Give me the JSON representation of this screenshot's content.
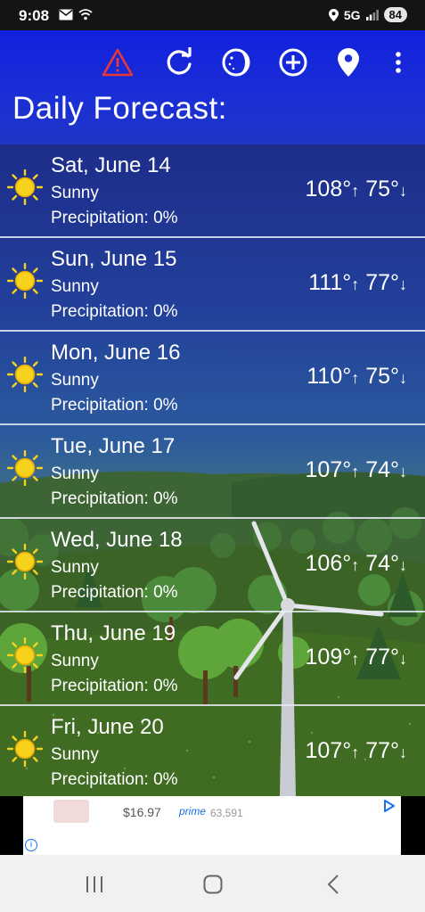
{
  "status_bar": {
    "time": "9:08",
    "network": "5G",
    "battery": "84"
  },
  "page_title": "Daily Forecast:",
  "toolbar_icons": [
    "alert-icon",
    "refresh-icon",
    "moon-icon",
    "add-location-icon",
    "location-pin-icon",
    "more-vert-icon"
  ],
  "days": [
    {
      "date": "Sat, June 14",
      "condition": "Sunny",
      "precipitation": "Precipitation:  0%",
      "high": "108°",
      "low": "75°"
    },
    {
      "date": "Sun, June 15",
      "condition": "Sunny",
      "precipitation": "Precipitation:  0%",
      "high": "111°",
      "low": "77°"
    },
    {
      "date": "Mon, June 16",
      "condition": "Sunny",
      "precipitation": "Precipitation:  0%",
      "high": "110°",
      "low": "75°"
    },
    {
      "date": "Tue, June 17",
      "condition": "Sunny",
      "precipitation": "Precipitation:  0%",
      "high": "107°",
      "low": "74°"
    },
    {
      "date": "Wed, June 18",
      "condition": "Sunny",
      "precipitation": "Precipitation:  0%",
      "high": "106°",
      "low": "74°"
    },
    {
      "date": "Thu, June 19",
      "condition": "Sunny",
      "precipitation": "Precipitation:  0%",
      "high": "109°",
      "low": "77°"
    },
    {
      "date": "Fri, June 20",
      "condition": "Sunny",
      "precipitation": "Precipitation:  0%",
      "high": "107°",
      "low": "77°"
    }
  ],
  "arrows": {
    "up": "↑",
    "down": "↓"
  },
  "ad": {
    "price": "$16.97",
    "prime": "prime",
    "count": "63,591"
  },
  "colors": {
    "toolbar": "#1b2fd6",
    "alert": "#e53935",
    "sun": "#f7d21c"
  }
}
